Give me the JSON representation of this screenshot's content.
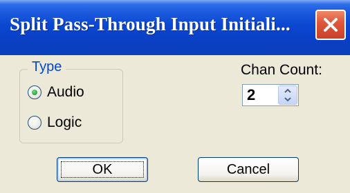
{
  "window": {
    "title": "Split Pass-Through Input Initiali..."
  },
  "type_group": {
    "title": "Type",
    "options": [
      {
        "label": "Audio",
        "selected": true
      },
      {
        "label": "Logic",
        "selected": false
      }
    ]
  },
  "chan_count": {
    "label": "Chan Count:",
    "value": "2"
  },
  "buttons": {
    "ok": "OK",
    "cancel": "Cancel"
  },
  "colors": {
    "titlebar": "#0a46d0",
    "close": "#e0583b",
    "dialog_bg": "#ece9d8",
    "group_title": "#0046d5",
    "radio_dot": "#2ea33a"
  },
  "icons": {
    "close": "close-icon",
    "spin_up": "chevron-up-icon",
    "spin_down": "chevron-down-icon"
  }
}
